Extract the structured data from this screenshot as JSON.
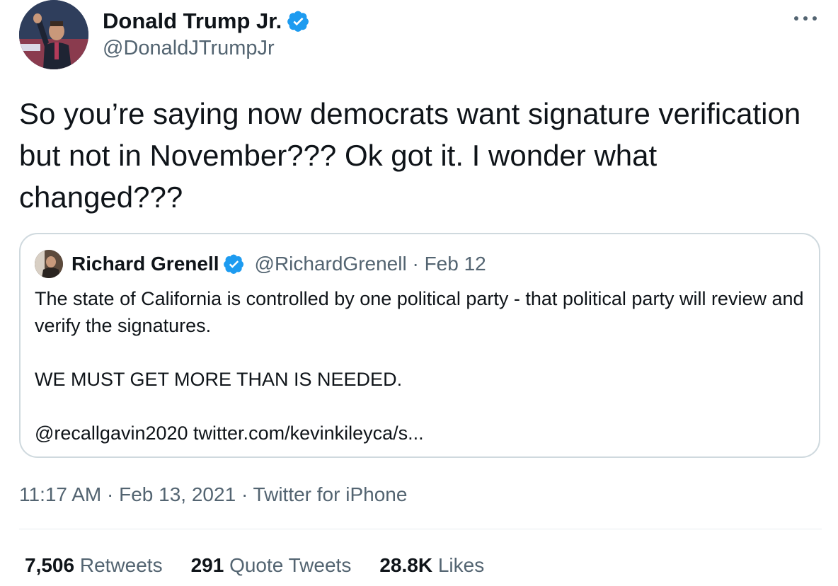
{
  "author": {
    "display_name": "Donald Trump Jr.",
    "handle": "@DonaldJTrumpJr"
  },
  "tweet": {
    "text": "So you’re saying now democrats want signature verification but not in November??? Ok got it. I wonder what changed???",
    "time": "11:17 AM",
    "date": "Feb 13, 2021",
    "client": "Twitter for iPhone",
    "separator": "·"
  },
  "quote": {
    "display_name": "Richard Grenell",
    "handle": "@RichardGrenell",
    "date": "Feb 12",
    "separator": "·",
    "line1": "The state of California is controlled by one political party - that political party will review and verify the signatures.",
    "line2": "WE MUST GET MORE THAN IS NEEDED.",
    "line3": "@recallgavin2020 twitter.com/kevinkileyca/s..."
  },
  "stats": {
    "retweets_count": "7,506",
    "retweets_label": "Retweets",
    "quotes_count": "291",
    "quotes_label": "Quote Tweets",
    "likes_count": "28.8K",
    "likes_label": "Likes"
  },
  "icons": {
    "verified": "verified-badge-icon",
    "more": "more-options-icon"
  },
  "colors": {
    "verified_blue": "#1d9bf0",
    "secondary_text": "#536471",
    "border": "#cfd9de"
  }
}
